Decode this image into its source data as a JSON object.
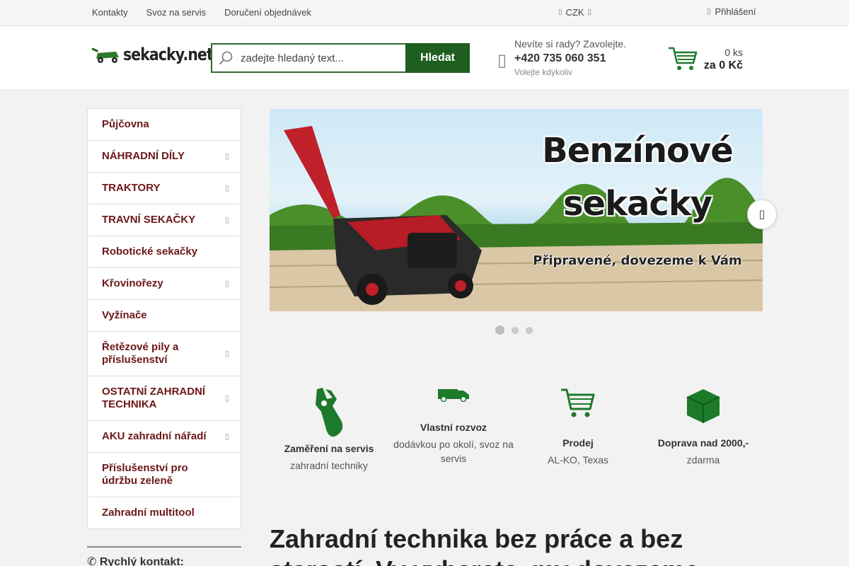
{
  "topbar": {
    "links": [
      "Kontakty",
      "Svoz na servis",
      "Doručení objednávek"
    ],
    "currency": "CZK",
    "login": "Přihlášení"
  },
  "header": {
    "logo_text": "sekacky.net",
    "search_placeholder": "zadejte hledaný text...",
    "search_button": "Hledat",
    "contact_question": "Nevíte si rady? Zavolejte.",
    "contact_phone": "+420 735 060 351",
    "contact_note": "Volejte kdykoliv",
    "cart_count": "0 ks",
    "cart_price": "za 0 Kč"
  },
  "sidebar": {
    "items": [
      {
        "label": "Půjčovna",
        "has_submenu": false
      },
      {
        "label": "NÁHRADNÍ DÍLY",
        "has_submenu": true
      },
      {
        "label": "TRAKTORY",
        "has_submenu": true
      },
      {
        "label": "TRAVNÍ SEKAČKY",
        "has_submenu": true
      },
      {
        "label": "Robotické sekačky",
        "has_submenu": false
      },
      {
        "label": "Křovinořezy",
        "has_submenu": true
      },
      {
        "label": "Vyžínače",
        "has_submenu": false
      },
      {
        "label": "Řetězové pily a příslušenství",
        "has_submenu": true
      },
      {
        "label": "OSTATNÍ ZAHRADNÍ TECHNIKA",
        "has_submenu": true
      },
      {
        "label": "AKU zahradní nářadí",
        "has_submenu": true
      },
      {
        "label": "Příslušenství pro údržbu zeleně",
        "has_submenu": false
      },
      {
        "label": "Zahradní multitool",
        "has_submenu": false
      }
    ],
    "quick_contact": "✆ Rychlý kontakt:"
  },
  "banner": {
    "title_line1": "Benzínové",
    "title_line2": "sekačky",
    "subtitle": "Připravené, dovezeme k Vám",
    "slides": 3,
    "active_slide": 1
  },
  "features": [
    {
      "title": "Zaměření na servis",
      "desc": "zahradní techniky",
      "icon": "wrench-icon"
    },
    {
      "title": "Vlastní rozvoz",
      "desc": "dodávkou po okolí, svoz na servis",
      "icon": "van-icon"
    },
    {
      "title": "Prodej",
      "desc": "AL-KO, Texas",
      "icon": "cart-icon"
    },
    {
      "title": "Doprava nad 2000,-",
      "desc": "zdarma",
      "icon": "box-icon"
    }
  ],
  "headline": "Zahradní technika bez práce a bez starostí. Vy vyberete, my dovezeme",
  "colors": {
    "brand_green": "#1f5e20",
    "menu_text": "#6d1717",
    "icon_green": "#1e7a2b"
  }
}
